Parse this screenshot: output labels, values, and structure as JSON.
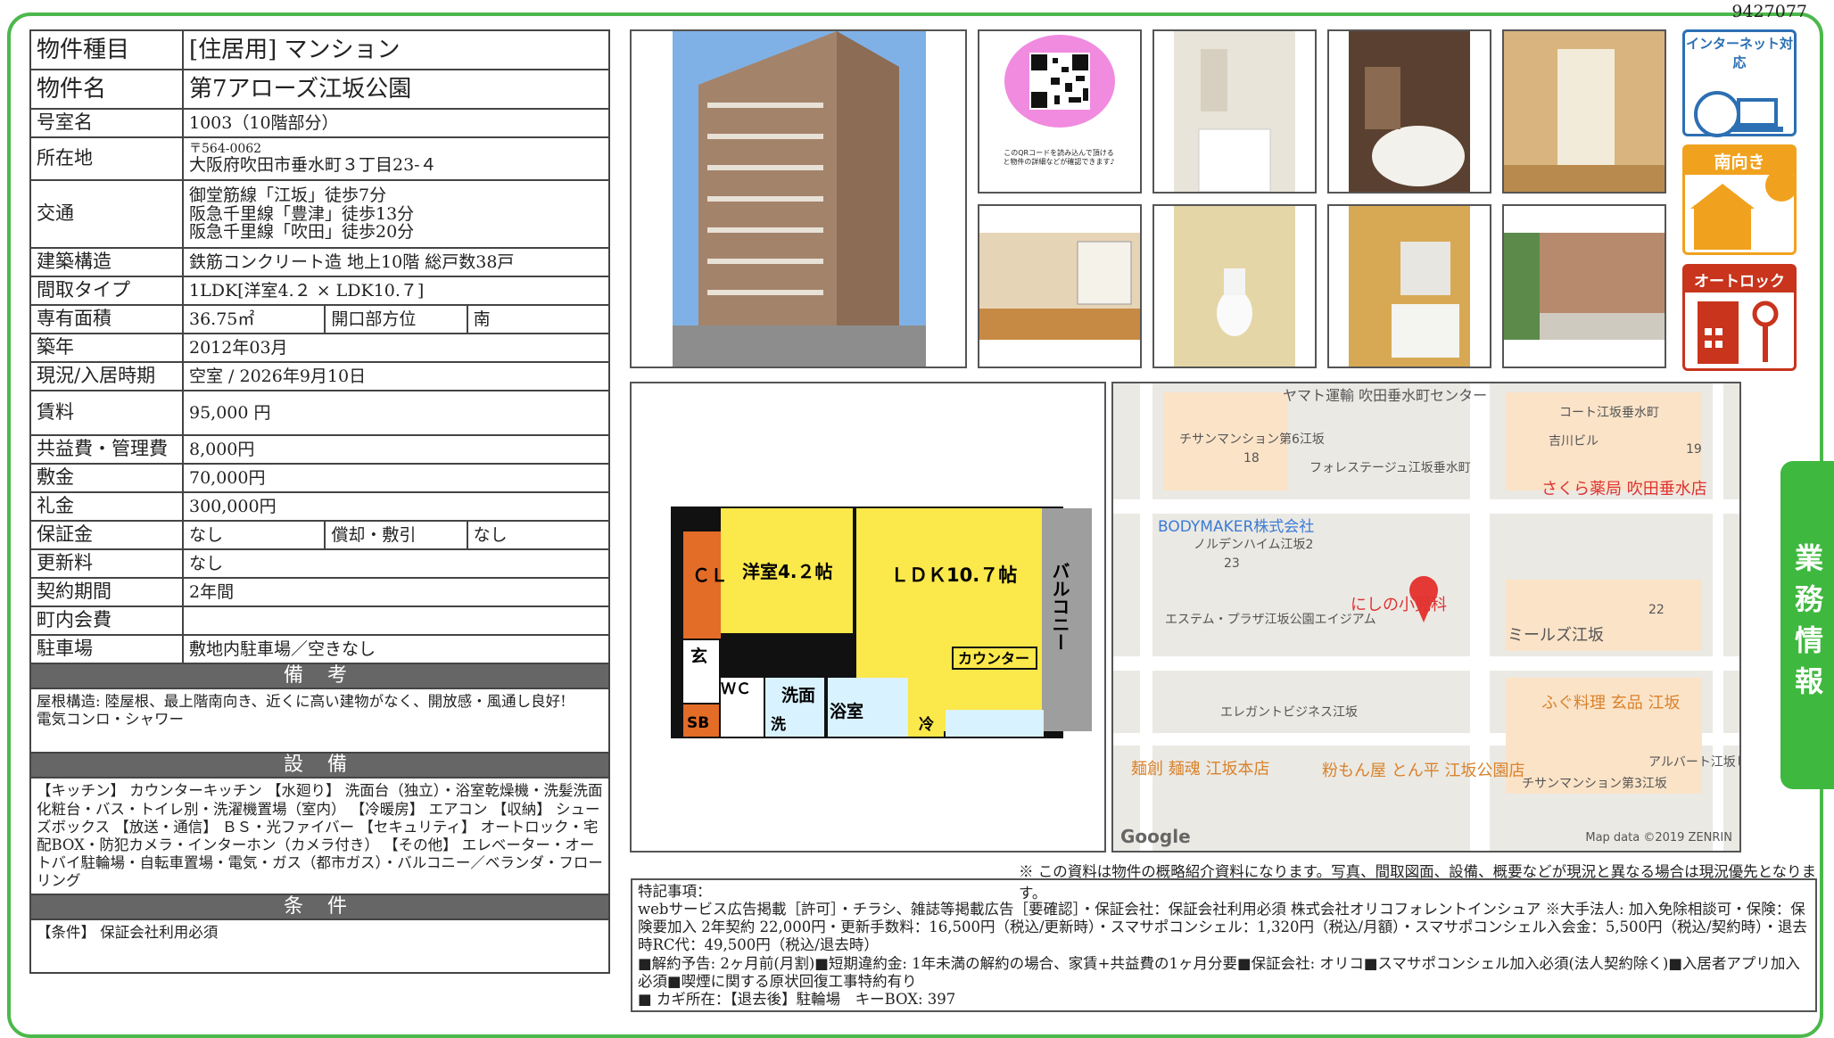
{
  "doc_id": "9427077",
  "spec": {
    "type_label": "物件種目",
    "type_value": "[住居用] マンション",
    "name_label": "物件名",
    "name_value": "第7アローズ江坂公園",
    "room_label": "号室名",
    "room_value": "1003（10階部分）",
    "address_label": "所在地",
    "address_zip": "〒564-0062",
    "address_value": "大阪府吹田市垂水町３丁目23-４",
    "transit_label": "交通",
    "transit": [
      "御堂筋線「江坂」徒歩7分",
      "阪急千里線「豊津」徒歩13分",
      "阪急千里線「吹田」徒歩20分"
    ],
    "structure_label": "建築構造",
    "structure_value": "鉄筋コンクリート造 地上10階 総戸数38戸",
    "layout_label": "間取タイプ",
    "layout_value": "1LDK[洋室4.２ × LDK10.７]",
    "area_label": "専有面積",
    "area_value": "36.75㎡",
    "orient_label": "開口部方位",
    "orient_value": "南",
    "built_label": "築年",
    "built_value": "2012年03月",
    "status_label": "現況/入居時期",
    "status_value": "空室 / 2026年9月10日",
    "rent_label": "賃料",
    "rent_value": "95,000 円",
    "fee_label": "共益費・管理費",
    "fee_value": "8,000円",
    "deposit_label": "敷金",
    "deposit_value": "70,000円",
    "keymoney_label": "礼金",
    "keymoney_value": "300,000円",
    "guarantee_label": "保証金",
    "guarantee_value": "なし",
    "amort_label": "償却・敷引",
    "amort_value": "なし",
    "renew_label": "更新料",
    "renew_value": "なし",
    "term_label": "契約期間",
    "term_value": "2年間",
    "assoc_label": "町内会費",
    "assoc_value": "",
    "parking_label": "駐車場",
    "parking_value": "敷地内駐車場／空きなし",
    "biko_header": "備 考",
    "biko_text": "屋根構造: 陸屋根、最上階南向き、近くに高い建物がなく、開放感・風通し良好!",
    "biko_text2": "電気コンロ・シャワー",
    "setsubi_header": "設 備",
    "setsubi_text": "【キッチン】 カウンターキッチン 【水廻り】 洗面台（独立）・浴室乾燥機・洗髪洗面化粧台・バス・トイレ別・洗濯機置場（室内） 【冷暖房】 エアコン 【収納】 シューズボックス 【放送・通信】 ＢＳ・光ファイバー 【セキュリティ】 オートロック・宅配BOX・防犯カメラ・インターホン（カメラ付き） 【その他】 エレベーター・オートバイ駐輪場・自転車置場・電気・ガス（都市ガス）・バルコニー／ベランダ・フローリング",
    "joken_header": "条 件",
    "joken_text": "【条件】 保証会社利用必須"
  },
  "qr_caption": "このQRコードを読み込んで頂けると物件の詳細などが確認できます♪",
  "icons": {
    "internet": "インターネット対応",
    "south": "南向き",
    "autolock": "オートロック"
  },
  "side_tab": "業務情報",
  "floorplan": {
    "cl": "ＣＬ",
    "western": "洋室4.２帖",
    "ldk": "ＬＤＫ10.７帖",
    "balcony": "バルコニー",
    "entrance": "玄",
    "sb": "SB",
    "wc": "ＷＣ",
    "wash": "洗面",
    "washer": "洗",
    "bath": "浴室",
    "counter": "カウンター",
    "fridge": "冷"
  },
  "map": {
    "labels": [
      "ヤマト運輸 吹田垂水町センター",
      "チサンマンション第6江坂",
      "18",
      "フォレステージュ江坂垂水町",
      "コート江坂垂水町",
      "吉川ビル",
      "19",
      "さくら薬局 吹田垂水店",
      "BODYMAKER株式会社",
      "ノルデンハイム江坂2",
      "23",
      "エステム・プラザ江坂公園エイジアム",
      "にしの小児科",
      "ミールズ江坂",
      "22",
      "エレガントビジネス江坂",
      "ふぐ料理 玄品 江坂",
      "麺創 麺魂 江坂本店",
      "粉もん屋 とん平 江坂公園店",
      "アルバート江坂ヒ",
      "チサンマンション第3江坂"
    ],
    "google": "Google",
    "copyright": "Map data ©2019 ZENRIN"
  },
  "disclaimer": "※ この資料は物件の概略紹介資料になります。写真、間取図面、設備、概要などが現況と異なる場合は現況優先となります。",
  "remarks": {
    "title": "特記事項：",
    "line1": "webサービス広告掲載［許可］・チラシ、雑誌等掲載広告［要確認］・保証会社：保証会社利用必須 株式会社オリコフォレントインシュア ※大手法人: 加入免除相談可・保険：保険要加入 2年契約 22,000円・更新手数料：16,500円（税込/更新時）・スマサポコンシェル：1,320円（税込/月額）・スマサポコンシェル入会金：5,500円（税込/契約時）・退去時RC代：49,500円（税込/退去時）",
    "line2": "■解約予告: 2ヶ月前(月割)■短期違約金: 1年未満の解約の場合、家賃+共益費の1ヶ月分要■保証会社: オリコ■スマサポコンシェル加入必須(法人契約除く)■入居者アプリ加入必須■喫煙に関する原状回復工事特約有り",
    "line3": "■ カギ所在：【退去後】駐輪場　キーBOX: 397"
  }
}
